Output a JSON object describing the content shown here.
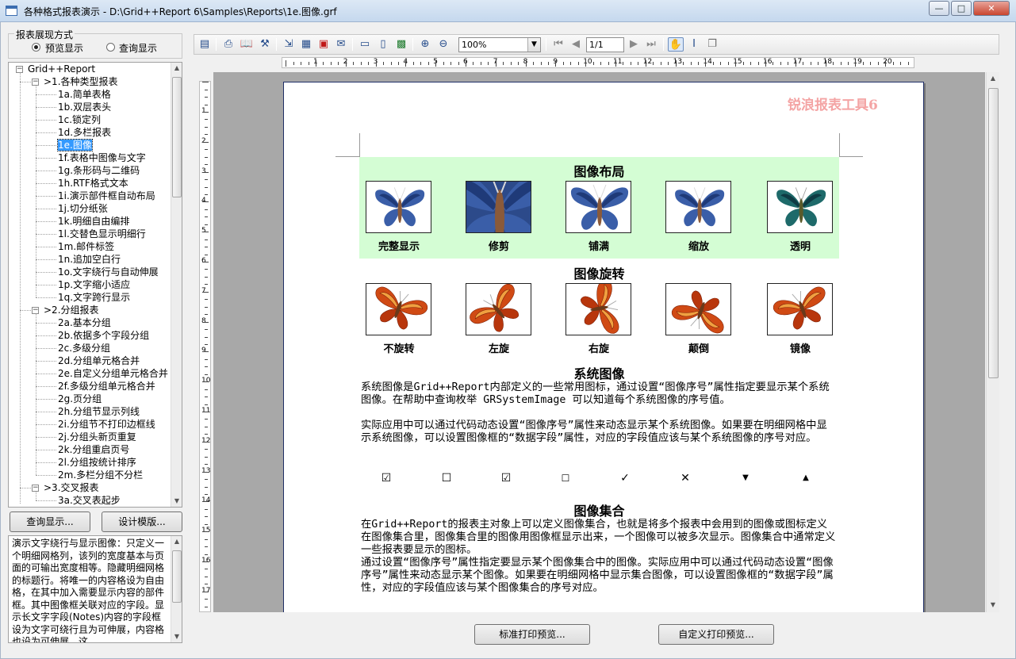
{
  "window": {
    "title": "各种格式报表演示 - D:\\Grid++Report 6\\Samples\\Reports\\1e.图像.grf"
  },
  "mode": {
    "label": "报表展现方式",
    "options": [
      "预览显示",
      "查询显示"
    ],
    "selected": "预览显示"
  },
  "tree": {
    "root": "Grid++Report",
    "groups": [
      {
        "label": ">1.各种类型报表",
        "items": [
          "1a.简单表格",
          "1b.双层表头",
          "1c.锁定列",
          "1d.多栏报表",
          "1e.图像",
          "1f.表格中图像与文字",
          "1g.条形码与二维码",
          "1h.RTF格式文本",
          "1i.演示部件框自动布局",
          "1j.切分纸张",
          "1k.明细自由编排",
          "1l.交替色显示明细行",
          "1m.邮件标签",
          "1n.追加空白行",
          "1o.文字绕行与自动伸展",
          "1p.文字缩小适应",
          "1q.文字跨行显示"
        ]
      },
      {
        "label": ">2.分组报表",
        "items": [
          "2a.基本分组",
          "2b.依据多个字段分组",
          "2c.多级分组",
          "2d.分组单元格合并",
          "2e.自定义分组单元格合并",
          "2f.多级分组单元格合并",
          "2g.页分组",
          "2h.分组节显示列线",
          "2i.分组节不打印边框线",
          "2j.分组头新页重复",
          "2k.分组重启页号",
          "2l.分组按统计排序",
          "2m.多栏分组不分栏"
        ]
      },
      {
        "label": ">3.交叉报表",
        "items": [
          "3a.交叉表起步"
        ]
      }
    ],
    "selected": "1e.图像"
  },
  "buttons": {
    "query": "查询显示...",
    "design": "设计模版...",
    "std_preview": "标准打印预览...",
    "custom_preview": "自定义打印预览..."
  },
  "description": "演示文字绕行与显示图像：只定义一个明细网格列，该列的宽度基本与页面的可输出宽度相等。隐藏明细网格的标题行。将唯一的内容格设为自由格，在其中加入需要显示内容的部件框。其中图像框关联对应的字段。显示长文字字段(Notes)内容的字段框设为文字可绕行且为可伸展，内容格也设为可伸展，这",
  "toolbar": {
    "zoom": "100%",
    "page": "1/1"
  },
  "ruler": {
    "h_marks": [
      "1",
      "2",
      "3",
      "4",
      "5",
      "6",
      "7",
      "8",
      "9",
      "10",
      "11",
      "12",
      "13",
      "14",
      "15",
      "16",
      "17",
      "18",
      "19",
      "20"
    ],
    "v_marks": [
      "1",
      "2",
      "3",
      "4",
      "5",
      "6",
      "7",
      "8",
      "9",
      "10",
      "11",
      "12",
      "13",
      "14",
      "15",
      "16",
      "17"
    ]
  },
  "report": {
    "watermark": "锐浪报表工具6",
    "layout_title": "图像布局",
    "layout_captions": [
      "完整显示",
      "修剪",
      "铺满",
      "缩放",
      "透明"
    ],
    "rotate_title": "图像旋转",
    "rotate_captions": [
      "不旋转",
      "左旋",
      "右旋",
      "颠倒",
      "镜像"
    ],
    "system_title": "系统图像",
    "system_para1": "系统图像是Grid++Report内部定义的一些常用图标，通过设置“图像序号”属性指定要显示某个系统图像。在帮助中查询枚举 GRSystemImage 可以知道每个系统图像的序号值。",
    "system_para2": "实际应用中可以通过代码动态设置“图像序号”属性来动态显示某个系统图像。如果要在明细网格中显示系统图像，可以设置图像框的“数据字段”属性，对应的字段值应该与某个系统图像的序号对应。",
    "system_icons": [
      "☑",
      "☐",
      "☑",
      "☐",
      "✓",
      "✕",
      "▼",
      "▲"
    ],
    "collection_title": "图像集合",
    "collection_para1": "在Grid++Report的报表主对象上可以定义图像集合，也就是将多个报表中会用到的图像或图标定义在图像集合里，图像集合里的图像用图像框显示出来，一个图像可以被多次显示。图像集合中通常定义一些报表要显示的图标。",
    "collection_para2": "通过设置“图像序号”属性指定要显示某个图像集合中的图像。实际应用中可以通过代码动态设置“图像序号”属性来动态显示某个图像。如果要在明细网格中显示集合图像，可以设置图像框的“数据字段”属性，对应的字段值应该与某个图像集合的序号对应。"
  },
  "colors": {
    "layout_band": "#d4fdd4",
    "watermark": "#f4a4a4"
  }
}
